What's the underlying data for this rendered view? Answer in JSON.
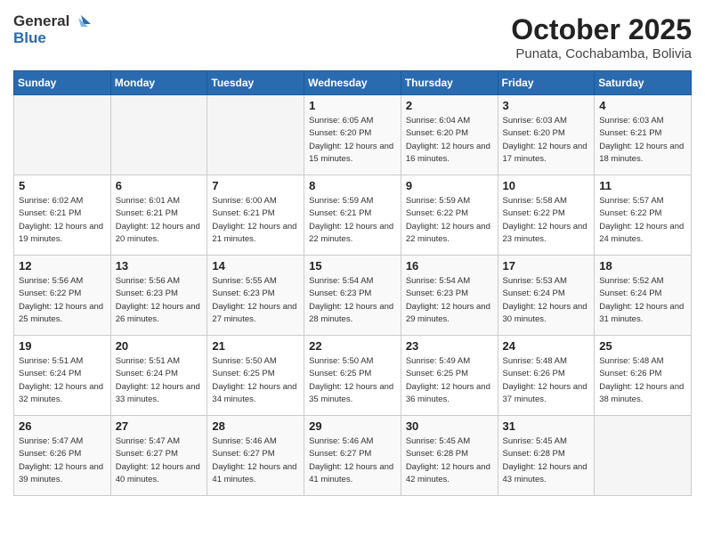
{
  "header": {
    "logo_general": "General",
    "logo_blue": "Blue",
    "month_title": "October 2025",
    "location": "Punata, Cochabamba, Bolivia"
  },
  "weekdays": [
    "Sunday",
    "Monday",
    "Tuesday",
    "Wednesday",
    "Thursday",
    "Friday",
    "Saturday"
  ],
  "weeks": [
    [
      {
        "day": "",
        "sunrise": "",
        "sunset": "",
        "daylight": ""
      },
      {
        "day": "",
        "sunrise": "",
        "sunset": "",
        "daylight": ""
      },
      {
        "day": "",
        "sunrise": "",
        "sunset": "",
        "daylight": ""
      },
      {
        "day": "1",
        "sunrise": "Sunrise: 6:05 AM",
        "sunset": "Sunset: 6:20 PM",
        "daylight": "Daylight: 12 hours and 15 minutes."
      },
      {
        "day": "2",
        "sunrise": "Sunrise: 6:04 AM",
        "sunset": "Sunset: 6:20 PM",
        "daylight": "Daylight: 12 hours and 16 minutes."
      },
      {
        "day": "3",
        "sunrise": "Sunrise: 6:03 AM",
        "sunset": "Sunset: 6:20 PM",
        "daylight": "Daylight: 12 hours and 17 minutes."
      },
      {
        "day": "4",
        "sunrise": "Sunrise: 6:03 AM",
        "sunset": "Sunset: 6:21 PM",
        "daylight": "Daylight: 12 hours and 18 minutes."
      }
    ],
    [
      {
        "day": "5",
        "sunrise": "Sunrise: 6:02 AM",
        "sunset": "Sunset: 6:21 PM",
        "daylight": "Daylight: 12 hours and 19 minutes."
      },
      {
        "day": "6",
        "sunrise": "Sunrise: 6:01 AM",
        "sunset": "Sunset: 6:21 PM",
        "daylight": "Daylight: 12 hours and 20 minutes."
      },
      {
        "day": "7",
        "sunrise": "Sunrise: 6:00 AM",
        "sunset": "Sunset: 6:21 PM",
        "daylight": "Daylight: 12 hours and 21 minutes."
      },
      {
        "day": "8",
        "sunrise": "Sunrise: 5:59 AM",
        "sunset": "Sunset: 6:21 PM",
        "daylight": "Daylight: 12 hours and 22 minutes."
      },
      {
        "day": "9",
        "sunrise": "Sunrise: 5:59 AM",
        "sunset": "Sunset: 6:22 PM",
        "daylight": "Daylight: 12 hours and 22 minutes."
      },
      {
        "day": "10",
        "sunrise": "Sunrise: 5:58 AM",
        "sunset": "Sunset: 6:22 PM",
        "daylight": "Daylight: 12 hours and 23 minutes."
      },
      {
        "day": "11",
        "sunrise": "Sunrise: 5:57 AM",
        "sunset": "Sunset: 6:22 PM",
        "daylight": "Daylight: 12 hours and 24 minutes."
      }
    ],
    [
      {
        "day": "12",
        "sunrise": "Sunrise: 5:56 AM",
        "sunset": "Sunset: 6:22 PM",
        "daylight": "Daylight: 12 hours and 25 minutes."
      },
      {
        "day": "13",
        "sunrise": "Sunrise: 5:56 AM",
        "sunset": "Sunset: 6:23 PM",
        "daylight": "Daylight: 12 hours and 26 minutes."
      },
      {
        "day": "14",
        "sunrise": "Sunrise: 5:55 AM",
        "sunset": "Sunset: 6:23 PM",
        "daylight": "Daylight: 12 hours and 27 minutes."
      },
      {
        "day": "15",
        "sunrise": "Sunrise: 5:54 AM",
        "sunset": "Sunset: 6:23 PM",
        "daylight": "Daylight: 12 hours and 28 minutes."
      },
      {
        "day": "16",
        "sunrise": "Sunrise: 5:54 AM",
        "sunset": "Sunset: 6:23 PM",
        "daylight": "Daylight: 12 hours and 29 minutes."
      },
      {
        "day": "17",
        "sunrise": "Sunrise: 5:53 AM",
        "sunset": "Sunset: 6:24 PM",
        "daylight": "Daylight: 12 hours and 30 minutes."
      },
      {
        "day": "18",
        "sunrise": "Sunrise: 5:52 AM",
        "sunset": "Sunset: 6:24 PM",
        "daylight": "Daylight: 12 hours and 31 minutes."
      }
    ],
    [
      {
        "day": "19",
        "sunrise": "Sunrise: 5:51 AM",
        "sunset": "Sunset: 6:24 PM",
        "daylight": "Daylight: 12 hours and 32 minutes."
      },
      {
        "day": "20",
        "sunrise": "Sunrise: 5:51 AM",
        "sunset": "Sunset: 6:24 PM",
        "daylight": "Daylight: 12 hours and 33 minutes."
      },
      {
        "day": "21",
        "sunrise": "Sunrise: 5:50 AM",
        "sunset": "Sunset: 6:25 PM",
        "daylight": "Daylight: 12 hours and 34 minutes."
      },
      {
        "day": "22",
        "sunrise": "Sunrise: 5:50 AM",
        "sunset": "Sunset: 6:25 PM",
        "daylight": "Daylight: 12 hours and 35 minutes."
      },
      {
        "day": "23",
        "sunrise": "Sunrise: 5:49 AM",
        "sunset": "Sunset: 6:25 PM",
        "daylight": "Daylight: 12 hours and 36 minutes."
      },
      {
        "day": "24",
        "sunrise": "Sunrise: 5:48 AM",
        "sunset": "Sunset: 6:26 PM",
        "daylight": "Daylight: 12 hours and 37 minutes."
      },
      {
        "day": "25",
        "sunrise": "Sunrise: 5:48 AM",
        "sunset": "Sunset: 6:26 PM",
        "daylight": "Daylight: 12 hours and 38 minutes."
      }
    ],
    [
      {
        "day": "26",
        "sunrise": "Sunrise: 5:47 AM",
        "sunset": "Sunset: 6:26 PM",
        "daylight": "Daylight: 12 hours and 39 minutes."
      },
      {
        "day": "27",
        "sunrise": "Sunrise: 5:47 AM",
        "sunset": "Sunset: 6:27 PM",
        "daylight": "Daylight: 12 hours and 40 minutes."
      },
      {
        "day": "28",
        "sunrise": "Sunrise: 5:46 AM",
        "sunset": "Sunset: 6:27 PM",
        "daylight": "Daylight: 12 hours and 41 minutes."
      },
      {
        "day": "29",
        "sunrise": "Sunrise: 5:46 AM",
        "sunset": "Sunset: 6:27 PM",
        "daylight": "Daylight: 12 hours and 41 minutes."
      },
      {
        "day": "30",
        "sunrise": "Sunrise: 5:45 AM",
        "sunset": "Sunset: 6:28 PM",
        "daylight": "Daylight: 12 hours and 42 minutes."
      },
      {
        "day": "31",
        "sunrise": "Sunrise: 5:45 AM",
        "sunset": "Sunset: 6:28 PM",
        "daylight": "Daylight: 12 hours and 43 minutes."
      },
      {
        "day": "",
        "sunrise": "",
        "sunset": "",
        "daylight": ""
      }
    ]
  ]
}
